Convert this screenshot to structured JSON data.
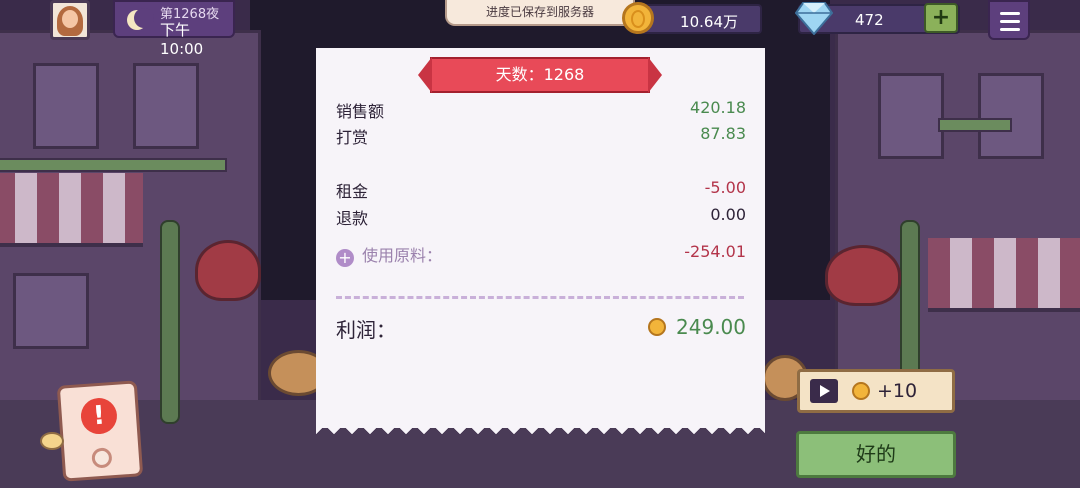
{
  "hud": {
    "day_title": "第1268夜",
    "time": "下午10:00",
    "toast": "进度已保存到服务器",
    "coins": "10.64万",
    "gems": "472",
    "plus_label": "+"
  },
  "receipt": {
    "ribbon": "天数：1268",
    "rows": [
      {
        "label": "销售额",
        "value": "420.18"
      },
      {
        "label": "打赏",
        "value": "87.83"
      },
      {
        "label": "租金",
        "value": "-5.00"
      },
      {
        "label": "退款",
        "value": "0.00"
      },
      {
        "label": "使用原料：",
        "value": "-254.01"
      }
    ],
    "profit_label": "利润：",
    "profit_value": "249.00"
  },
  "buttons": {
    "ad_reward": "+10",
    "ok": "好的"
  },
  "icons": [
    "avatar-portrait",
    "moon-icon",
    "coin-icon",
    "diamond-icon",
    "menu-icon",
    "plus-circle-icon",
    "play-icon",
    "alert-icon"
  ],
  "colors": {
    "positive": "#4a8a4f",
    "negative": "#b3344a",
    "ribbon": "#e84a58",
    "ok_button": "#8cbf79"
  }
}
